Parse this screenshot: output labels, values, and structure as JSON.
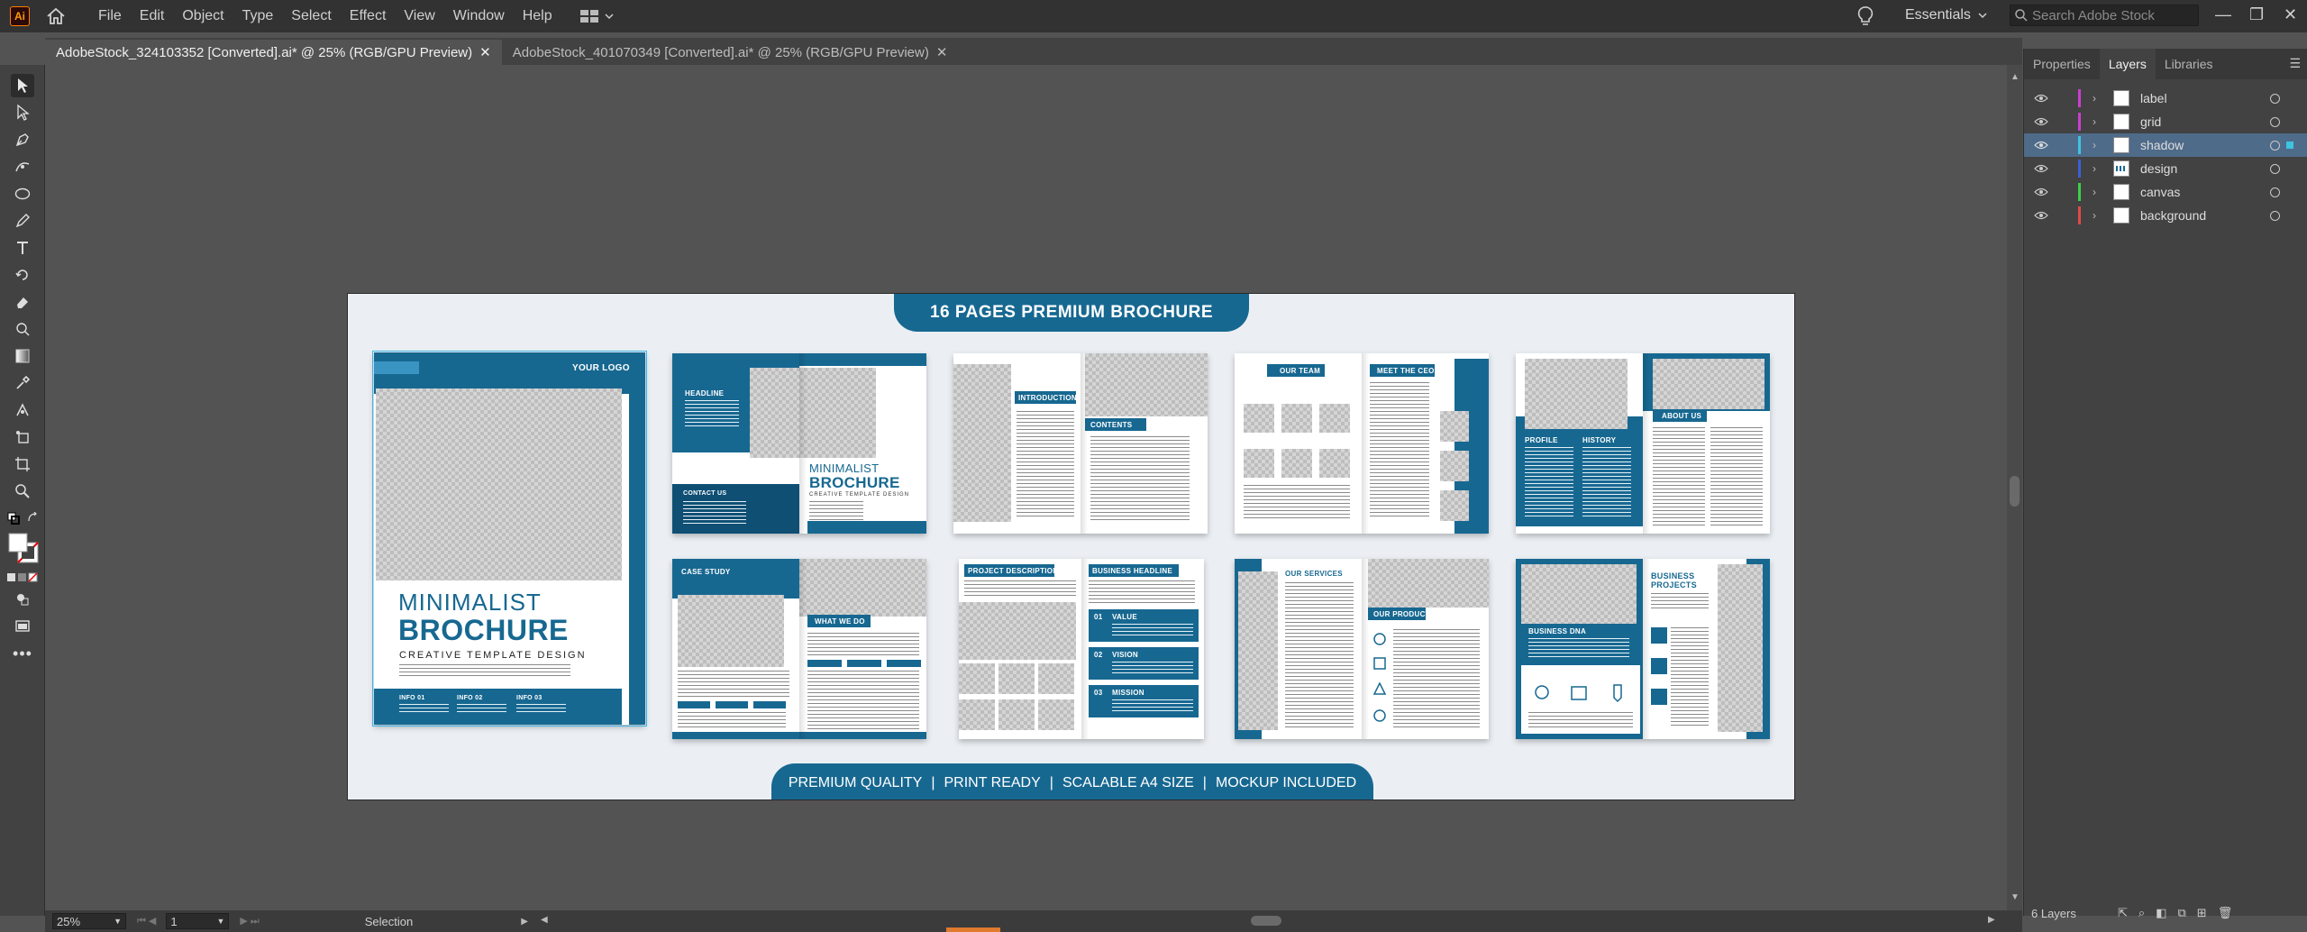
{
  "app": {
    "logo_text": "Ai"
  },
  "menu": [
    "File",
    "Edit",
    "Object",
    "Type",
    "Select",
    "Effect",
    "View",
    "Window",
    "Help"
  ],
  "workspace": {
    "name": "Essentials"
  },
  "stock_search": {
    "placeholder": "Search Adobe Stock"
  },
  "tabs": [
    {
      "label": "AdobeStock_324103352 [Converted].ai* @ 25% (RGB/GPU Preview)",
      "active": true
    },
    {
      "label": "AdobeStock_401070349 [Converted].ai* @ 25% (RGB/GPU Preview)",
      "active": false
    }
  ],
  "artboard": {
    "title": "16 PAGES PREMIUM BROCHURE",
    "footer": [
      "PREMIUM QUALITY",
      "|",
      "PRINT READY",
      "|",
      "SCALABLE A4 SIZE",
      "|",
      "MOCKUP INCLUDED"
    ],
    "cover": {
      "logo": "YOUR LOGO",
      "line1": "MINIMALIST",
      "line2": "BROCHURE",
      "line3": "CREATIVE TEMPLATE DESIGN",
      "info": [
        "INFO 01",
        "INFO 02",
        "INFO 03"
      ]
    },
    "spreads": {
      "s1": {
        "headline": "HEADLINE",
        "contact": "CONTACT US",
        "title1": "MINIMALIST",
        "title2": "BROCHURE",
        "sub": "CREATIVE TEMPLATE DESIGN"
      },
      "s2": {
        "intro": "INTRODUCTION",
        "contents": "CONTENTS"
      },
      "s3": {
        "team": "OUR TEAM",
        "ceo": "MEET THE CEO"
      },
      "s4": {
        "about": "ABOUT US",
        "profile": "PROFILE",
        "history": "HISTORY"
      },
      "s5": {
        "case": "CASE STUDY",
        "what": "WHAT WE DO"
      },
      "s6": {
        "project": "PROJECT DESCRIPTION",
        "business": "BUSINESS HEADLINE",
        "items": [
          "VALUE",
          "VISION",
          "MISSION"
        ],
        "nums": [
          "01",
          "02",
          "03"
        ]
      },
      "s7": {
        "services": "OUR SERVICES",
        "products": "OUR PRODUCTS"
      },
      "s8": {
        "dna": "BUSINESS DNA",
        "projects1": "BUSINESS",
        "projects2": "PROJECTS"
      }
    }
  },
  "panel": {
    "tabs": [
      "Properties",
      "Layers",
      "Libraries"
    ],
    "active_tab": "Layers",
    "layers": [
      {
        "name": "label",
        "color": "#c93fd0"
      },
      {
        "name": "grid",
        "color": "#c93fd0"
      },
      {
        "name": "shadow",
        "color": "#3ec3e0",
        "selected": true
      },
      {
        "name": "design",
        "color": "#3c5fd6"
      },
      {
        "name": "canvas",
        "color": "#3fce4b"
      },
      {
        "name": "background",
        "color": "#e04a4a"
      }
    ],
    "footer_count": "6 Layers"
  },
  "status": {
    "zoom": "25%",
    "artboard_number": "1",
    "tool": "Selection"
  }
}
